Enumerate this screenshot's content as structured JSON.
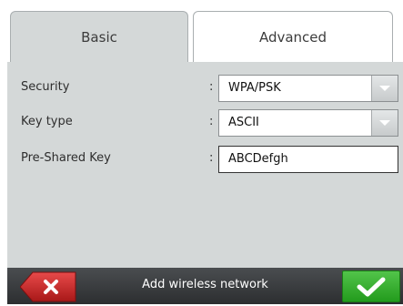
{
  "tabs": [
    {
      "label": "Basic",
      "active": true
    },
    {
      "label": "Advanced",
      "active": false
    }
  ],
  "form": {
    "security": {
      "label": "Security",
      "separator": ":",
      "value": "WPA/PSK"
    },
    "key_type": {
      "label": "Key type",
      "separator": ":",
      "value": "ASCII"
    },
    "psk": {
      "label": "Pre-Shared Key",
      "separator": ":",
      "value": "ABCDefgh"
    }
  },
  "bottom_bar": {
    "title": "Add wireless network",
    "cancel_icon": "close-icon",
    "ok_icon": "checkmark-icon"
  },
  "colors": {
    "panel": "#d4d8d8",
    "bottom_bar": "#3a3d40",
    "cancel": "#c62828",
    "ok": "#2fae28"
  }
}
